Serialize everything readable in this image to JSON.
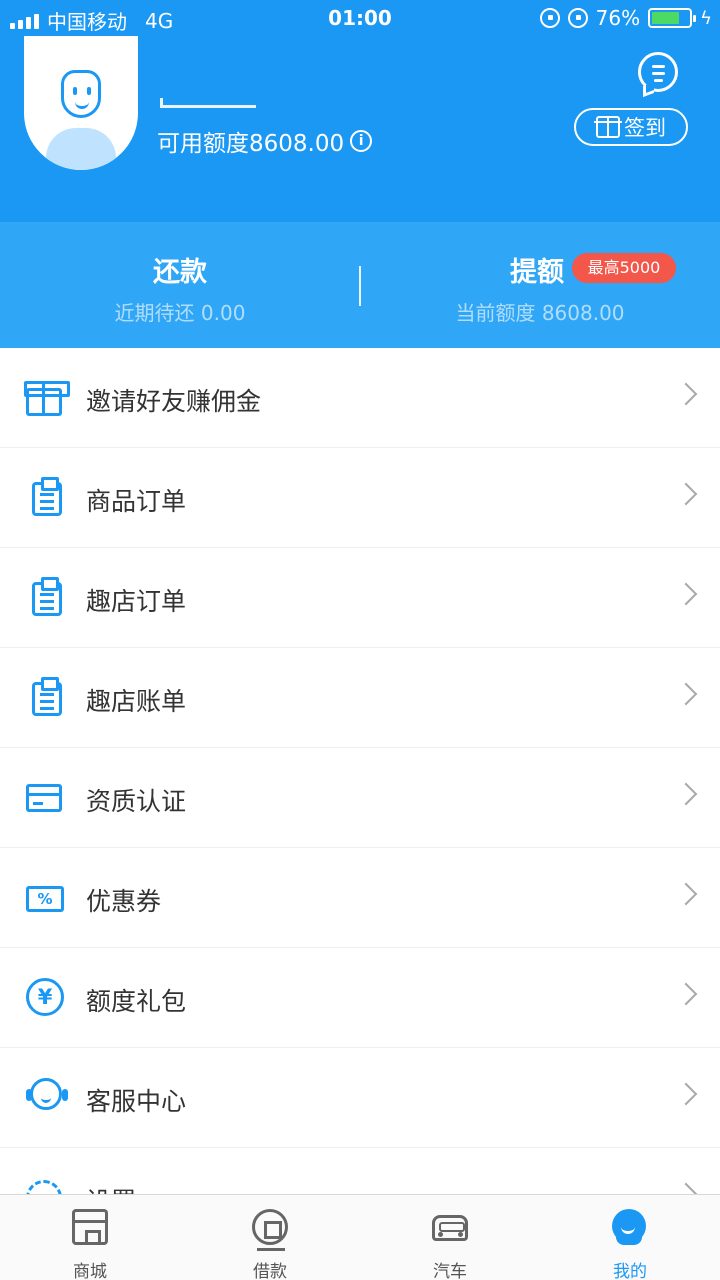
{
  "status_bar": {
    "carrier": "中国移动",
    "network": "4G",
    "time": "01:00",
    "battery_percent": "76%",
    "battery_level": 0.76
  },
  "header": {
    "credit_label": "可用额度8608.00",
    "info_icon": "info-icon",
    "signin_label": "签到",
    "message_icon": "message-icon"
  },
  "stats": {
    "repay_title": "还款",
    "repay_sub": "近期待还 0.00",
    "raise_title": "提额",
    "raise_badge": "最高5000",
    "raise_sub": "当前额度 8608.00"
  },
  "menu": {
    "items": [
      {
        "label": "邀请好友赚佣金",
        "icon": "gift-icon"
      },
      {
        "label": "商品订单",
        "icon": "clipboard-icon"
      },
      {
        "label": "趣店订单",
        "icon": "clipboard-icon"
      },
      {
        "label": "趣店账单",
        "icon": "clipboard-icon"
      },
      {
        "label": "资质认证",
        "icon": "card-icon"
      },
      {
        "label": "优惠券",
        "icon": "coupon-icon"
      },
      {
        "label": "额度礼包",
        "icon": "yen-coin-icon"
      },
      {
        "label": "客服中心",
        "icon": "headset-icon"
      },
      {
        "label": "设置",
        "icon": "gear-icon"
      }
    ]
  },
  "tabbar": {
    "tabs": [
      {
        "label": "商城",
        "icon": "shop-icon"
      },
      {
        "label": "借款",
        "icon": "loan-icon"
      },
      {
        "label": "汽车",
        "icon": "car-icon"
      },
      {
        "label": "我的",
        "icon": "profile-icon"
      }
    ],
    "active_color": "#1a98f4"
  },
  "colors": {
    "brand_blue": "#1a98f4",
    "badge_red": "#f3574a"
  }
}
